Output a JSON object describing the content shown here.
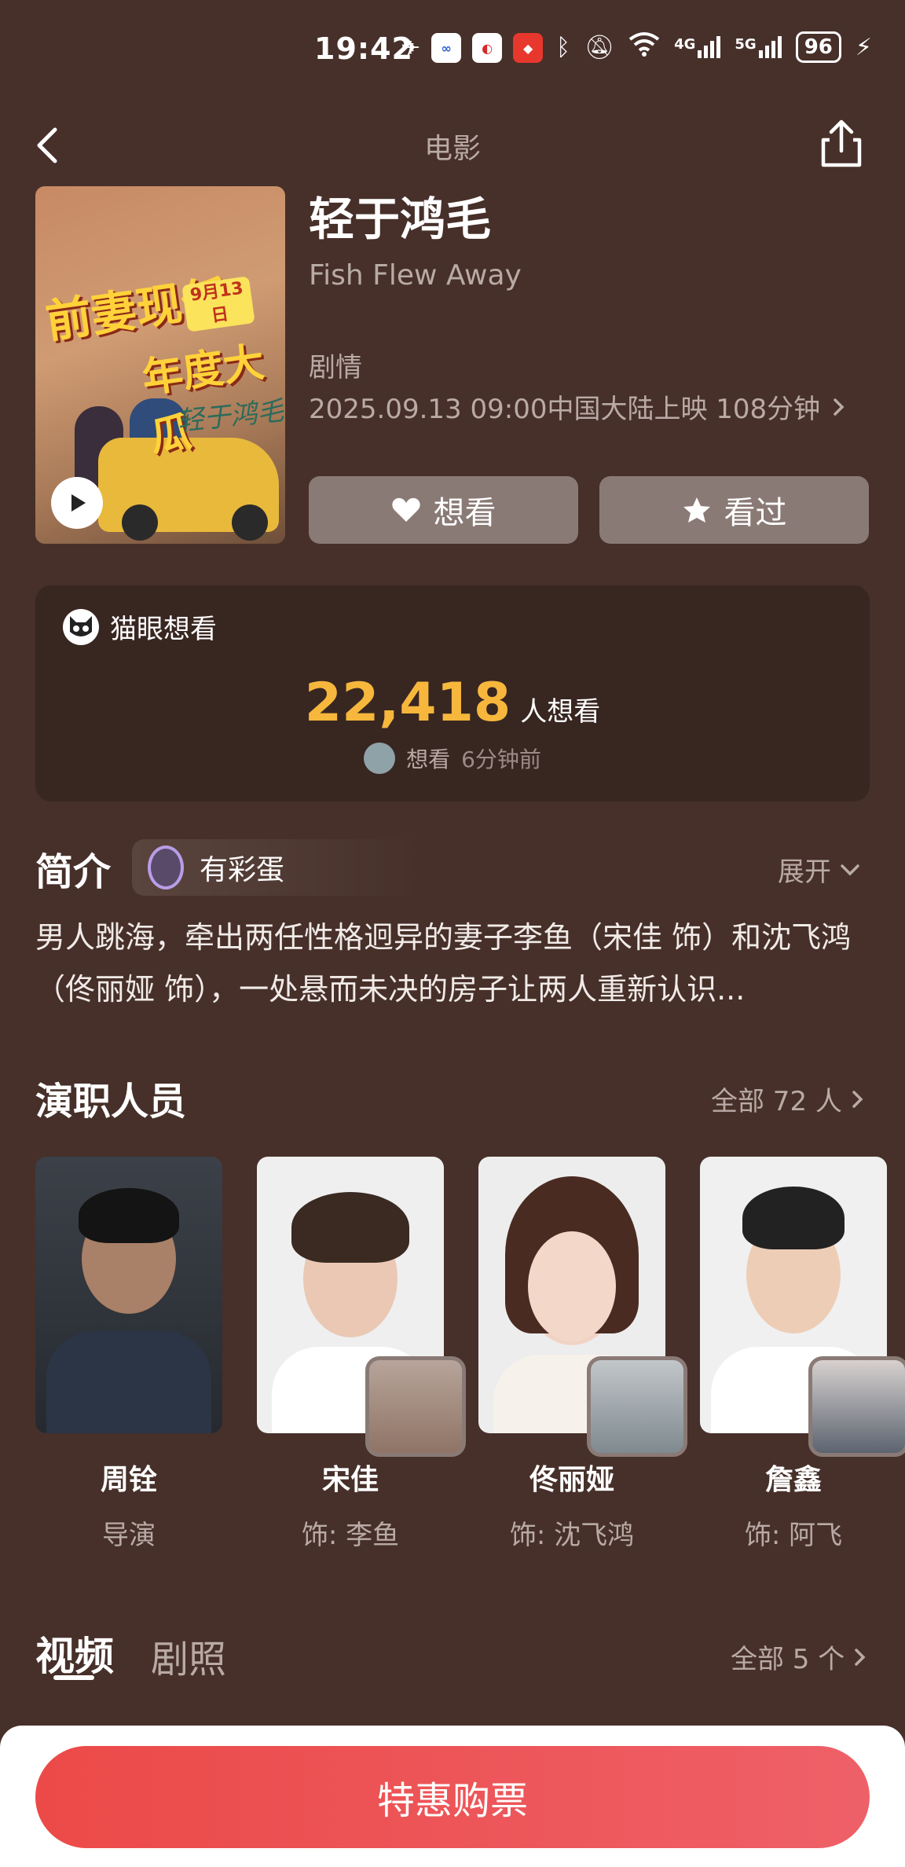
{
  "status_bar": {
    "time": "19:42",
    "battery": "96",
    "network_4g": "4G",
    "network_5g": "5G",
    "icons": [
      "paper-plane-icon",
      "app-icon-blue",
      "app-icon-red",
      "app-icon-red-2",
      "bluetooth-icon",
      "mute-icon",
      "wifi-icon",
      "signal-icon",
      "charging-icon"
    ]
  },
  "nav": {
    "title": "电影"
  },
  "movie": {
    "title": "轻于鸿毛",
    "english_title": "Fish Flew Away",
    "genre": "剧情",
    "release": "2025.09.13 09:00中国大陆上映 108分钟",
    "poster": {
      "headline_1": "前妻现任",
      "headline_2": "年度大瓜",
      "date_badge": "9月13日",
      "signature": "轻于鸿毛"
    }
  },
  "actions": {
    "want": "想看",
    "seen": "看过"
  },
  "want_box": {
    "brand": "猫眼想看",
    "count": "22,418",
    "count_unit": "人想看",
    "recent_action": "想看",
    "recent_time": "6分钟前"
  },
  "intro": {
    "title": "简介",
    "easter_egg": "有彩蛋",
    "expand": "展开",
    "text": "男人跳海，牵出两任性格迥异的妻子李鱼（宋佳 饰）和沈飞鸿（佟丽娅 饰），一处悬而未决的房子让两人重新认识..."
  },
  "cast": {
    "title": "演职人员",
    "all": "全部 72 人",
    "members": [
      {
        "name": "周铨",
        "role": "导演"
      },
      {
        "name": "宋佳",
        "role": "饰: 李鱼"
      },
      {
        "name": "佟丽娅",
        "role": "饰: 沈飞鸿"
      },
      {
        "name": "詹鑫",
        "role": "饰: 阿飞"
      }
    ]
  },
  "media": {
    "tab_video": "视频",
    "tab_photo": "剧照",
    "all": "全部 5 个"
  },
  "footer": {
    "buy": "特惠购票"
  },
  "colors": {
    "background": "#47302a",
    "accent_orange": "#f6b73c",
    "buy_button": "#ec4a48"
  }
}
